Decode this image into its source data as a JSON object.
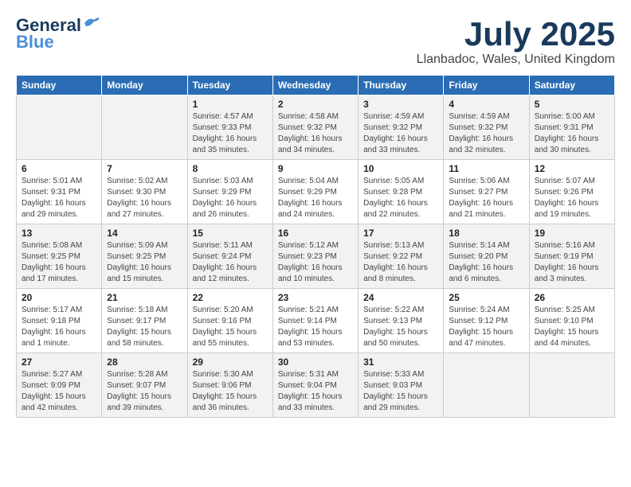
{
  "header": {
    "logo_line1": "General",
    "logo_line2": "Blue",
    "month_title": "July 2025",
    "location": "Llanbadoc, Wales, United Kingdom"
  },
  "weekdays": [
    "Sunday",
    "Monday",
    "Tuesday",
    "Wednesday",
    "Thursday",
    "Friday",
    "Saturday"
  ],
  "weeks": [
    [
      {
        "day": "",
        "info": ""
      },
      {
        "day": "",
        "info": ""
      },
      {
        "day": "1",
        "info": "Sunrise: 4:57 AM\nSunset: 9:33 PM\nDaylight: 16 hours\nand 35 minutes."
      },
      {
        "day": "2",
        "info": "Sunrise: 4:58 AM\nSunset: 9:32 PM\nDaylight: 16 hours\nand 34 minutes."
      },
      {
        "day": "3",
        "info": "Sunrise: 4:59 AM\nSunset: 9:32 PM\nDaylight: 16 hours\nand 33 minutes."
      },
      {
        "day": "4",
        "info": "Sunrise: 4:59 AM\nSunset: 9:32 PM\nDaylight: 16 hours\nand 32 minutes."
      },
      {
        "day": "5",
        "info": "Sunrise: 5:00 AM\nSunset: 9:31 PM\nDaylight: 16 hours\nand 30 minutes."
      }
    ],
    [
      {
        "day": "6",
        "info": "Sunrise: 5:01 AM\nSunset: 9:31 PM\nDaylight: 16 hours\nand 29 minutes."
      },
      {
        "day": "7",
        "info": "Sunrise: 5:02 AM\nSunset: 9:30 PM\nDaylight: 16 hours\nand 27 minutes."
      },
      {
        "day": "8",
        "info": "Sunrise: 5:03 AM\nSunset: 9:29 PM\nDaylight: 16 hours\nand 26 minutes."
      },
      {
        "day": "9",
        "info": "Sunrise: 5:04 AM\nSunset: 9:29 PM\nDaylight: 16 hours\nand 24 minutes."
      },
      {
        "day": "10",
        "info": "Sunrise: 5:05 AM\nSunset: 9:28 PM\nDaylight: 16 hours\nand 22 minutes."
      },
      {
        "day": "11",
        "info": "Sunrise: 5:06 AM\nSunset: 9:27 PM\nDaylight: 16 hours\nand 21 minutes."
      },
      {
        "day": "12",
        "info": "Sunrise: 5:07 AM\nSunset: 9:26 PM\nDaylight: 16 hours\nand 19 minutes."
      }
    ],
    [
      {
        "day": "13",
        "info": "Sunrise: 5:08 AM\nSunset: 9:25 PM\nDaylight: 16 hours\nand 17 minutes."
      },
      {
        "day": "14",
        "info": "Sunrise: 5:09 AM\nSunset: 9:25 PM\nDaylight: 16 hours\nand 15 minutes."
      },
      {
        "day": "15",
        "info": "Sunrise: 5:11 AM\nSunset: 9:24 PM\nDaylight: 16 hours\nand 12 minutes."
      },
      {
        "day": "16",
        "info": "Sunrise: 5:12 AM\nSunset: 9:23 PM\nDaylight: 16 hours\nand 10 minutes."
      },
      {
        "day": "17",
        "info": "Sunrise: 5:13 AM\nSunset: 9:22 PM\nDaylight: 16 hours\nand 8 minutes."
      },
      {
        "day": "18",
        "info": "Sunrise: 5:14 AM\nSunset: 9:20 PM\nDaylight: 16 hours\nand 6 minutes."
      },
      {
        "day": "19",
        "info": "Sunrise: 5:16 AM\nSunset: 9:19 PM\nDaylight: 16 hours\nand 3 minutes."
      }
    ],
    [
      {
        "day": "20",
        "info": "Sunrise: 5:17 AM\nSunset: 9:18 PM\nDaylight: 16 hours\nand 1 minute."
      },
      {
        "day": "21",
        "info": "Sunrise: 5:18 AM\nSunset: 9:17 PM\nDaylight: 15 hours\nand 58 minutes."
      },
      {
        "day": "22",
        "info": "Sunrise: 5:20 AM\nSunset: 9:16 PM\nDaylight: 15 hours\nand 55 minutes."
      },
      {
        "day": "23",
        "info": "Sunrise: 5:21 AM\nSunset: 9:14 PM\nDaylight: 15 hours\nand 53 minutes."
      },
      {
        "day": "24",
        "info": "Sunrise: 5:22 AM\nSunset: 9:13 PM\nDaylight: 15 hours\nand 50 minutes."
      },
      {
        "day": "25",
        "info": "Sunrise: 5:24 AM\nSunset: 9:12 PM\nDaylight: 15 hours\nand 47 minutes."
      },
      {
        "day": "26",
        "info": "Sunrise: 5:25 AM\nSunset: 9:10 PM\nDaylight: 15 hours\nand 44 minutes."
      }
    ],
    [
      {
        "day": "27",
        "info": "Sunrise: 5:27 AM\nSunset: 9:09 PM\nDaylight: 15 hours\nand 42 minutes."
      },
      {
        "day": "28",
        "info": "Sunrise: 5:28 AM\nSunset: 9:07 PM\nDaylight: 15 hours\nand 39 minutes."
      },
      {
        "day": "29",
        "info": "Sunrise: 5:30 AM\nSunset: 9:06 PM\nDaylight: 15 hours\nand 36 minutes."
      },
      {
        "day": "30",
        "info": "Sunrise: 5:31 AM\nSunset: 9:04 PM\nDaylight: 15 hours\nand 33 minutes."
      },
      {
        "day": "31",
        "info": "Sunrise: 5:33 AM\nSunset: 9:03 PM\nDaylight: 15 hours\nand 29 minutes."
      },
      {
        "day": "",
        "info": ""
      },
      {
        "day": "",
        "info": ""
      }
    ]
  ]
}
